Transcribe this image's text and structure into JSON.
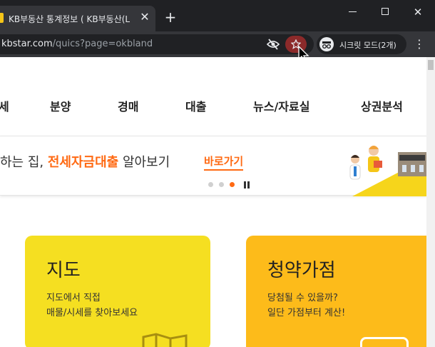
{
  "browser": {
    "tab_title": "KB부동산 통계정보 ( KB부동산(L",
    "tab_close": "✕",
    "new_tab": "+",
    "url_host": "kbstar.com",
    "url_path": "/quics?page=okbland",
    "incognito_label": "시크릿 모드(2개)",
    "menu": "⋮",
    "close_glyph": "✕"
  },
  "nav": {
    "items": [
      {
        "label": "세"
      },
      {
        "label": "분양"
      },
      {
        "label": "경매"
      },
      {
        "label": "대출"
      },
      {
        "label": "뉴스/자료실"
      },
      {
        "label": "상권분석"
      }
    ]
  },
  "banner": {
    "text_before": "하는 집, ",
    "text_highlight": "전세자금대출",
    "text_after": " 알아보기",
    "link": "바로가기",
    "slide_count": 3,
    "active_slide": 3
  },
  "cards": [
    {
      "title": "지도",
      "desc_line1": "지도에서 직접",
      "desc_line2": "매물/시세를 찾아보세요"
    },
    {
      "title": "청약가점",
      "desc_line1": "당첨될 수 있을까?",
      "desc_line2": "일단 가점부터 계산!"
    }
  ],
  "colors": {
    "accent": "#ff6a13",
    "card_map": "#f5df21",
    "card_subscription": "#fdbb1a",
    "chrome_dark": "#202124",
    "star_active": "#8c2a2a"
  }
}
